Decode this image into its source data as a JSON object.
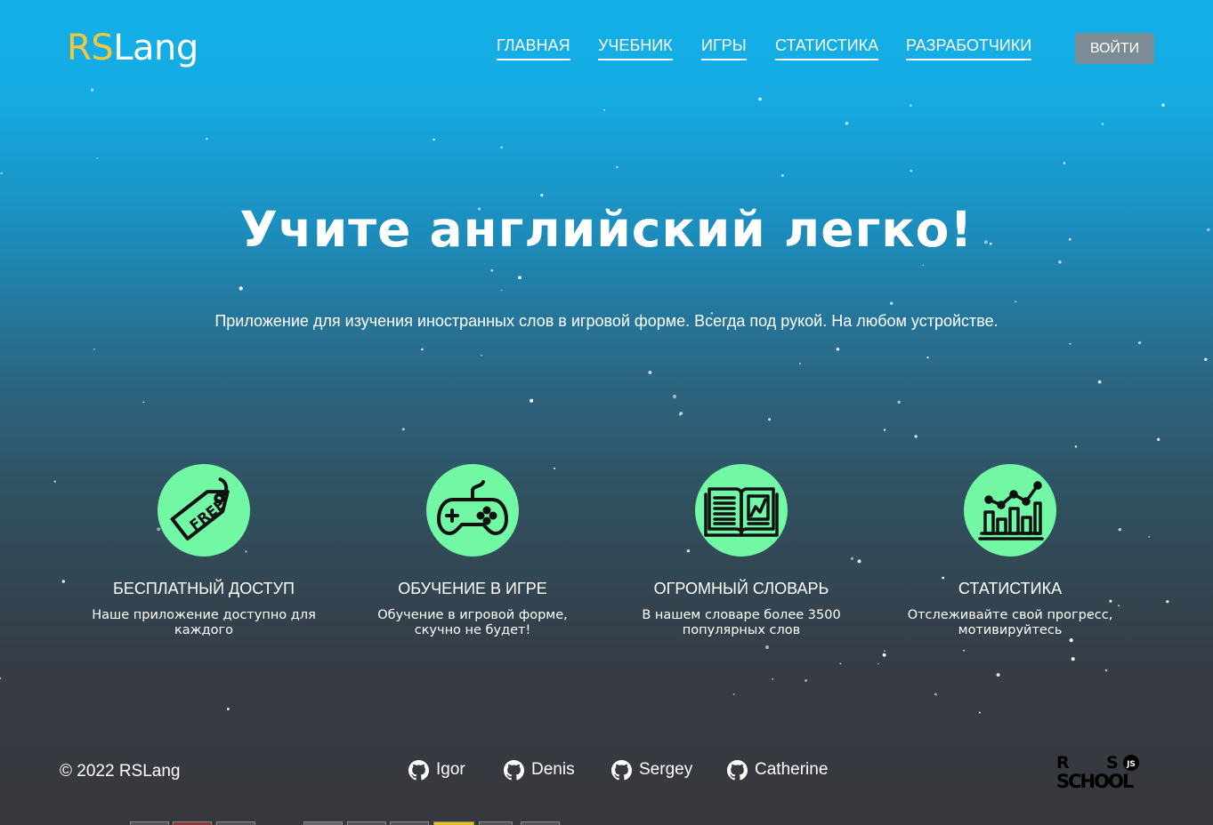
{
  "header": {
    "logo": {
      "part1": "RS",
      "part2": "Lang"
    },
    "nav": [
      {
        "label": "ГЛАВНАЯ"
      },
      {
        "label": "УЧЕБНИК"
      },
      {
        "label": "ИГРЫ"
      },
      {
        "label": "СТАТИСТИКА"
      },
      {
        "label": "РАЗРАБОТЧИКИ"
      }
    ],
    "login_label": "ВОЙТИ"
  },
  "hero": {
    "title": "Учите английский легко!",
    "subtitle": "Приложение для изучения иностранных слов в игровой форме. Всегда под рукой. На любом устройстве."
  },
  "features": [
    {
      "icon": "free-tag-icon",
      "title": "БЕСПЛАТНЫЙ ДОСТУП",
      "desc": "Наше приложение доступно для каждого"
    },
    {
      "icon": "gamepad-icon",
      "title": "ОБУЧЕНИЕ В ИГРЕ",
      "desc": "Обучение в игровой форме, скучно не будет!"
    },
    {
      "icon": "dictionary-book-icon",
      "title": "ОГРОМНЫЙ СЛОВАРЬ",
      "desc": "В нашем словаре более 3500 популярных слов"
    },
    {
      "icon": "statistics-chart-icon",
      "title": "СТАТИСТИКА",
      "desc": "Отслеживайте свой прогресс, мотивируйтесь"
    }
  ],
  "footer": {
    "copyright": "© 2022 RSLang",
    "developers": [
      {
        "name": "Igor",
        "icon": "github-icon"
      },
      {
        "name": "Denis",
        "icon": "github-icon"
      },
      {
        "name": "Sergey",
        "icon": "github-icon"
      },
      {
        "name": "Catherine",
        "icon": "github-icon"
      }
    ],
    "school_logo": {
      "text": "RS SCHOOL",
      "badge": "JS"
    }
  },
  "colors": {
    "background_top": "#13afe8",
    "background_bottom": "#37383d",
    "accent_green": "#72f7a5",
    "logo_yellow": "#f0c83c",
    "button_gray": "#7b8c96"
  }
}
